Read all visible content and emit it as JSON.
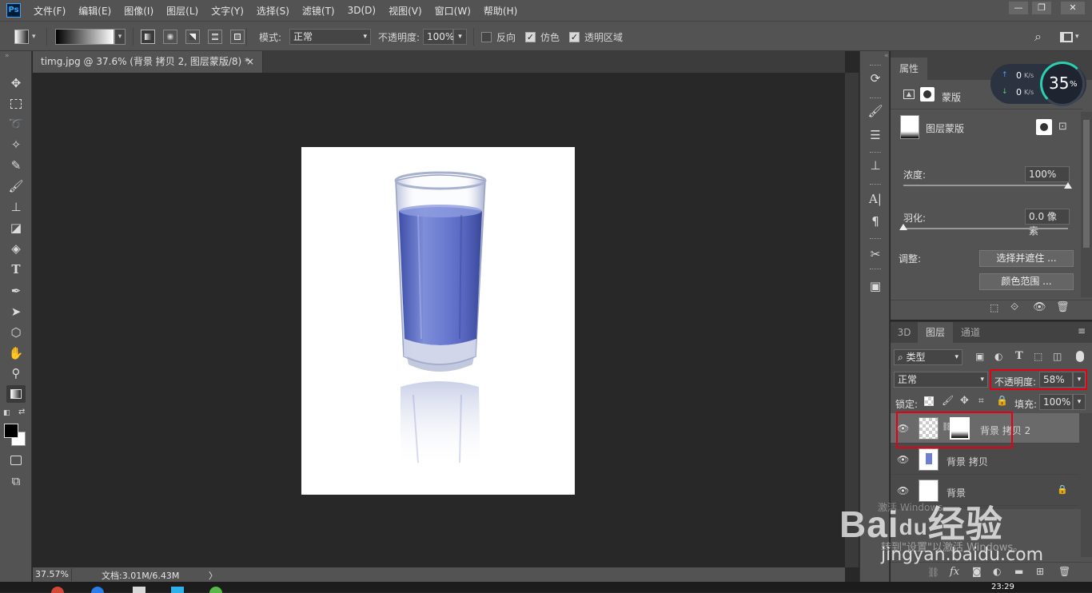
{
  "menubar": {
    "logo": "Ps",
    "items": [
      "文件(F)",
      "编辑(E)",
      "图像(I)",
      "图层(L)",
      "文字(Y)",
      "选择(S)",
      "滤镜(T)",
      "3D(D)",
      "视图(V)",
      "窗口(W)",
      "帮助(H)"
    ],
    "window_buttons": {
      "minimize": "—",
      "restore": "❐",
      "close": "✕"
    }
  },
  "options": {
    "mode_label": "模式:",
    "mode_value": "正常",
    "opacity_label": "不透明度:",
    "opacity_value": "100%",
    "reverse_label": "反向",
    "reverse_checked": false,
    "dither_label": "仿色",
    "dither_checked": true,
    "transparency_label": "透明区域",
    "transparency_checked": true
  },
  "document": {
    "tab_title": "timg.jpg @ 37.6% (背景 拷贝 2, 图层蒙版/8) *",
    "tab_close": "×",
    "zoom": "37.57%",
    "doc_info": "文档:3.01M/6.43M",
    "status_arrow": "〉"
  },
  "properties": {
    "tab_label": "属性",
    "mask_label": "蒙版",
    "layer_mask_label": "图层蒙版",
    "density_label": "浓度:",
    "density_value": "100%",
    "density_fraction": 1.0,
    "feather_label": "羽化:",
    "feather_value": "0.0 像素",
    "feather_fraction": 0.0,
    "adjust_label": "调整:",
    "select_mask_button": "选择并遮住 ...",
    "color_range_button": "颜色范围 ..."
  },
  "layers_panel": {
    "tabs": [
      "3D",
      "图层",
      "通道"
    ],
    "active_tab": "图层",
    "filter_label": "类型",
    "blend_mode": "正常",
    "opacity_label": "不透明度:",
    "opacity_value": "58%",
    "lock_label": "锁定:",
    "fill_label": "填充:",
    "fill_value": "100%",
    "layers": [
      {
        "name": "背景 拷贝 2",
        "selected": true
      },
      {
        "name": "背景 拷贝",
        "selected": false
      },
      {
        "name": "背景",
        "selected": false
      }
    ],
    "bottom_icons": [
      "link-icon",
      "fx-icon",
      "mask-icon",
      "adjustment-icon",
      "group-icon",
      "new-layer-icon",
      "trash-icon"
    ],
    "fx_label": "fx"
  },
  "net_widget": {
    "up_speed": "0",
    "up_unit": "K/s",
    "down_speed": "0",
    "down_unit": "K/s",
    "percent": "35",
    "percent_sign": "%"
  },
  "watermark": {
    "brand": "Bai",
    "brand_paw": "du",
    "brand_suffix": "经验",
    "site": "jingyan.baidu.com",
    "activate_line1": "激活 Windows",
    "activate_line2": "转到\"设置\"以激活 Windows。"
  },
  "taskbar": {
    "time": "23:29"
  },
  "colors": {
    "panel": "#535353",
    "canvas": "#282828",
    "highlight": "#e60012",
    "water": "#6f7fcf"
  }
}
